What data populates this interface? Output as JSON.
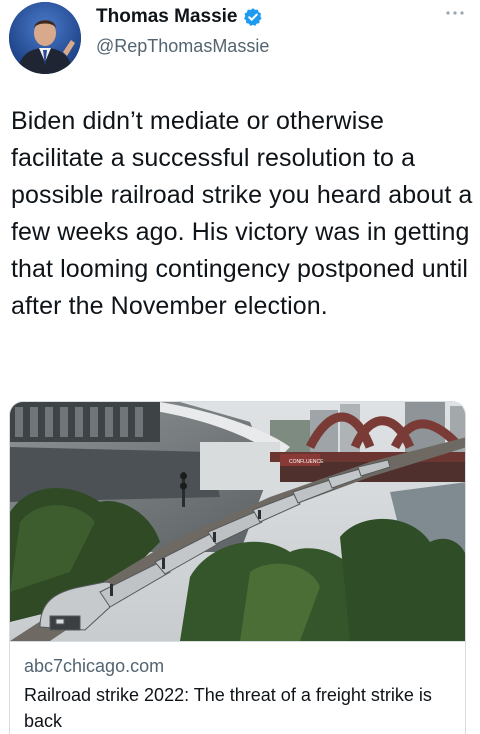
{
  "tweet": {
    "author_name": "Thomas Massie",
    "handle": "@RepThomasMassie",
    "text": "Biden didn’t mediate or otherwise facilitate a successful resolution to a possible railroad strike you heard about a few weeks ago. His victory was in getting that looming contingency postponed until after the November election.",
    "verified": true
  },
  "link_card": {
    "domain": "abc7chicago.com",
    "title": "Railroad strike 2022: The threat of a freight strike is back",
    "image_sign_text": "CONFLUENCE"
  },
  "colors": {
    "verified_blue": "#1d9bf0",
    "secondary_text": "#536471",
    "primary_text": "#0f1419",
    "border": "#d6dce0"
  },
  "icons": {
    "verified": "verified-badge-icon",
    "more": "more-dots-icon"
  }
}
